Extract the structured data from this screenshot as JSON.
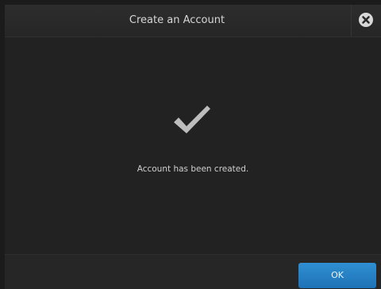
{
  "dialog": {
    "title": "Create an Account",
    "close_icon": "close-icon",
    "check_icon": "checkmark-icon",
    "message": "Account has been created.",
    "ok_label": "OK"
  },
  "colors": {
    "accent": "#1e7fc4",
    "background": "#222222"
  }
}
